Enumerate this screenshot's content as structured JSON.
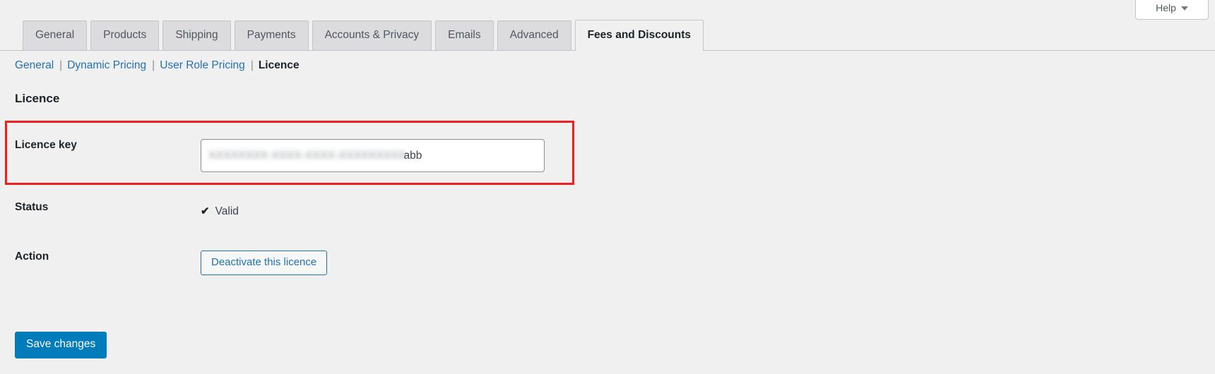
{
  "help": {
    "label": "Help",
    "caret_icon": "chevron-down-icon"
  },
  "tabs": [
    {
      "label": "General",
      "active": false
    },
    {
      "label": "Products",
      "active": false
    },
    {
      "label": "Shipping",
      "active": false
    },
    {
      "label": "Payments",
      "active": false
    },
    {
      "label": "Accounts & Privacy",
      "active": false
    },
    {
      "label": "Emails",
      "active": false
    },
    {
      "label": "Advanced",
      "active": false
    },
    {
      "label": "Fees and Discounts",
      "active": true
    }
  ],
  "subnav": {
    "items": [
      {
        "label": "General",
        "current": false
      },
      {
        "label": "Dynamic Pricing",
        "current": false
      },
      {
        "label": "User Role Pricing",
        "current": false
      },
      {
        "label": "Licence",
        "current": true
      }
    ],
    "separator": "|"
  },
  "section": {
    "heading": "Licence"
  },
  "form": {
    "licence_key": {
      "label": "Licence key",
      "value_redacted": "XXXXXXXX-XXXX-XXXX-XXXXXXXXX",
      "value_visible_tail": "abb",
      "placeholder": ""
    },
    "status": {
      "label": "Status",
      "check_icon": "checkmark-icon",
      "check_glyph": "✔",
      "value": "Valid"
    },
    "action": {
      "label": "Action",
      "button_label": "Deactivate this licence"
    }
  },
  "save": {
    "label": "Save changes"
  },
  "colors": {
    "page_background": "#f0f0f1",
    "link": "#2271b1",
    "primary_button": "#007cba",
    "highlight_outline": "#f02020",
    "tab_inactive": "#dcdcde",
    "border": "#c3c4c7"
  }
}
